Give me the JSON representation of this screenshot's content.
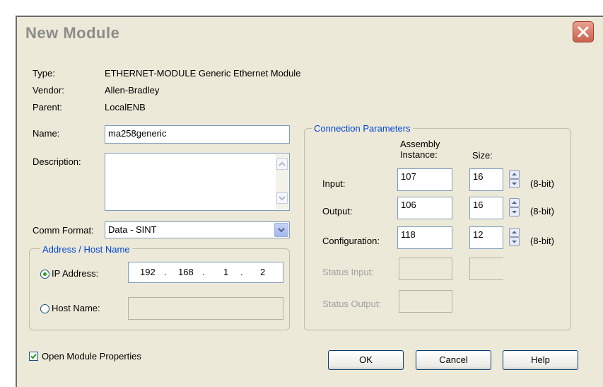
{
  "dialog": {
    "title": "New Module"
  },
  "info": {
    "type_label": "Type:",
    "type_value": "ETHERNET-MODULE Generic Ethernet Module",
    "vendor_label": "Vendor:",
    "vendor_value": "Allen-Bradley",
    "parent_label": "Parent:",
    "parent_value": "LocalENB",
    "name_label": "Name:",
    "name_value": "ma258generic",
    "description_label": "Description:",
    "description_value": "",
    "comm_format_label": "Comm Format:",
    "comm_format_value": "Data - SINT"
  },
  "address": {
    "group_label": "Address / Host Name",
    "ip_label": "IP Address:",
    "ip_selected": true,
    "ip_octets": [
      "192",
      "168",
      "1",
      "2"
    ],
    "host_label": "Host Name:",
    "host_value": ""
  },
  "connection": {
    "group_label": "Connection Parameters",
    "assembly_header_line1": "Assembly",
    "assembly_header_line2": "Instance:",
    "size_header": "Size:",
    "rows": [
      {
        "label": "Input:",
        "instance": "107",
        "size": "16",
        "unit": "(8-bit)"
      },
      {
        "label": "Output:",
        "instance": "106",
        "size": "16",
        "unit": "(8-bit)"
      },
      {
        "label": "Configuration:",
        "instance": "118",
        "size": "12",
        "unit": "(8-bit)"
      }
    ],
    "status_input_label": "Status Input:",
    "status_output_label": "Status Output:"
  },
  "footer": {
    "open_properties_label": "Open Module Properties",
    "open_properties_checked": true,
    "ok_label": "OK",
    "cancel_label": "Cancel",
    "help_label": "Help"
  },
  "colors": {
    "dialog_bg": "#ece9d8",
    "group_title": "#0046d5",
    "close_button": "#c9644f",
    "radio_dot": "#21a121"
  }
}
